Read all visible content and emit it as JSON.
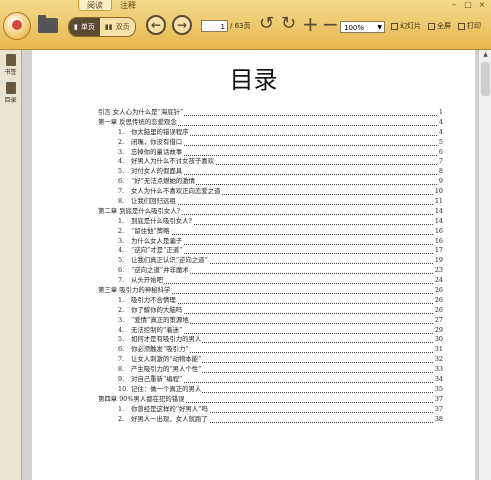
{
  "tabs": [
    "阅读",
    "注释"
  ],
  "toolbar": {
    "single_page": "单页",
    "double_page": "双页",
    "current_page": "1",
    "total_pages": "/ 63页",
    "zoom": "100%",
    "slideshow": "幻灯片",
    "fullscreen": "全屏",
    "print": "打印"
  },
  "sidebar": [
    {
      "label": "书签"
    },
    {
      "label": "目录"
    }
  ],
  "document": {
    "title": "目录",
    "toc": [
      {
        "level": 0,
        "text": "引言  女人心为什么是“海底针”",
        "page": "1"
      },
      {
        "level": 0,
        "text": "第一章  反思传统的恋爱观念",
        "page": "4"
      },
      {
        "level": 1,
        "num": "1.",
        "text": "你大脑里的错误程序",
        "page": "4"
      },
      {
        "level": 1,
        "num": "2.",
        "text": "闭嘴，你没有借口",
        "page": "5"
      },
      {
        "level": 1,
        "num": "3.",
        "text": "忘掉你的童话故事",
        "page": "6"
      },
      {
        "level": 1,
        "num": "4.",
        "text": "好男人为什么不讨女孩子喜欢",
        "page": "7"
      },
      {
        "level": 1,
        "num": "5.",
        "text": "对付女人的假面具",
        "page": "8"
      },
      {
        "level": 1,
        "num": "6.",
        "text": "“好”无法点燃她的激情",
        "page": "9"
      },
      {
        "level": 1,
        "num": "7.",
        "text": "女人为什么不喜欢正向恋爱之道",
        "page": "10"
      },
      {
        "level": 1,
        "num": "8.",
        "text": "让我们回归远祖",
        "page": "11"
      },
      {
        "level": 0,
        "text": "第二章  到底是什么吸引女人?",
        "page": "14"
      },
      {
        "level": 1,
        "num": "1.",
        "text": "到底是什么吸引女人?",
        "page": "14"
      },
      {
        "level": 1,
        "num": "2.",
        "text": "“留住他”策略",
        "page": "16"
      },
      {
        "level": 1,
        "num": "3.",
        "text": "为什么女人是骗子",
        "page": "16"
      },
      {
        "level": 1,
        "num": "4.",
        "text": "“逆向”才是“正道”",
        "page": "17"
      },
      {
        "level": 1,
        "num": "5.",
        "text": "让我们真正认识“逆向之道”",
        "page": "19"
      },
      {
        "level": 1,
        "num": "6.",
        "text": "“逆向之道”并非魔术",
        "page": "23"
      },
      {
        "level": 1,
        "num": "7.",
        "text": "从头开始吧",
        "page": "24"
      },
      {
        "level": 0,
        "text": "第三章  吸引力的神秘科学",
        "page": "26"
      },
      {
        "level": 1,
        "num": "1.",
        "text": "吸引力不合情理",
        "page": "26"
      },
      {
        "level": 1,
        "num": "2.",
        "text": "你了解你的大脑吗",
        "page": "26"
      },
      {
        "level": 1,
        "num": "3.",
        "text": "“爱情”真正的策源地",
        "page": "27"
      },
      {
        "level": 1,
        "num": "4.",
        "text": "无法控制的“着迷”",
        "page": "29"
      },
      {
        "level": 1,
        "num": "5.",
        "text": "如何才是有吸引力的男人",
        "page": "30"
      },
      {
        "level": 1,
        "num": "6.",
        "text": "你必须触发“吸引力”",
        "page": "31"
      },
      {
        "level": 1,
        "num": "7.",
        "text": "让女人刺激的“动物本能”",
        "page": "32"
      },
      {
        "level": 1,
        "num": "8.",
        "text": "产生吸引力的“男人个性”",
        "page": "33"
      },
      {
        "level": 1,
        "num": "9.",
        "text": "对自己重新“编程”",
        "page": "34"
      },
      {
        "level": 1,
        "num": "10.",
        "text": "记住：做一个真正的男人",
        "page": "35"
      },
      {
        "level": 0,
        "text": "第四章  90%男人都在犯的错误",
        "page": "37"
      },
      {
        "level": 1,
        "num": "1.",
        "text": "你曾经是这样的“好男人”吗",
        "page": "37"
      },
      {
        "level": 1,
        "num": "2.",
        "text": "好男人一出现，女人就跑了",
        "page": "38"
      }
    ]
  }
}
